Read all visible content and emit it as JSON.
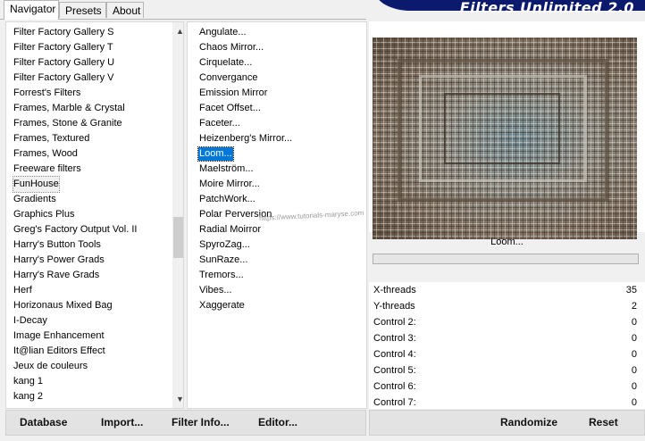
{
  "tabs": [
    {
      "label": "Navigator",
      "active": true
    },
    {
      "label": "Presets",
      "active": false
    },
    {
      "label": "About",
      "active": false
    }
  ],
  "banner": {
    "title": "Filters Unlimited 2.0"
  },
  "categories": [
    "Filter Factory Gallery S",
    "Filter Factory Gallery T",
    "Filter Factory Gallery U",
    "Filter Factory Gallery V",
    "Forrest's Filters",
    "Frames, Marble & Crystal",
    "Frames, Stone & Granite",
    "Frames, Textured",
    "Frames, Wood",
    "Freeware filters",
    "FunHouse",
    "Gradients",
    "Graphics Plus",
    "Greg's Factory Output Vol. II",
    "Harry's Button Tools",
    "Harry's Power Grads",
    "Harry's Rave Grads",
    "Herf",
    "Horizonaus Mixed Bag",
    "I-Decay",
    "Image Enhancement",
    "It@lian Editors Effect",
    "Jeux de couleurs",
    "kang 1",
    "kang 2"
  ],
  "selected_category": "FunHouse",
  "filters": [
    "Angulate...",
    "Chaos Mirror...",
    "Cirquelate...",
    "Convergance",
    "Emission Mirror",
    "Facet Offset...",
    "Faceter...",
    "Heizenberg's Mirror...",
    "Loom...",
    "Maelström...",
    "Moire Mirror...",
    "PatchWork...",
    "Polar Perversion",
    "Radial Moirror",
    "SpyroZag...",
    "SunRaze...",
    "Tremors...",
    "Vibes...",
    "Xaggerate"
  ],
  "selected_filter": "Loom...",
  "preview": {
    "filter_name": "Loom...",
    "watermark": "https://www.tutorials-maryse.com"
  },
  "progress": {
    "fraction": 0.0
  },
  "controls": [
    {
      "label": "X-threads",
      "value": "35"
    },
    {
      "label": "Y-threads",
      "value": "2"
    },
    {
      "label": "Control 2:",
      "value": "0"
    },
    {
      "label": "Control 3:",
      "value": "0"
    },
    {
      "label": "Control 4:",
      "value": "0"
    },
    {
      "label": "Control 5:",
      "value": "0"
    },
    {
      "label": "Control 6:",
      "value": "0"
    },
    {
      "label": "Control 7:",
      "value": "0"
    }
  ],
  "buttons_left": {
    "database": "Database",
    "import": "Import...",
    "filter_info": "Filter Info...",
    "editor": "Editor..."
  },
  "buttons_right": {
    "randomize": "Randomize",
    "reset": "Reset"
  },
  "colors": {
    "selection": "#0078d7",
    "banner": "#0c1a6e"
  }
}
